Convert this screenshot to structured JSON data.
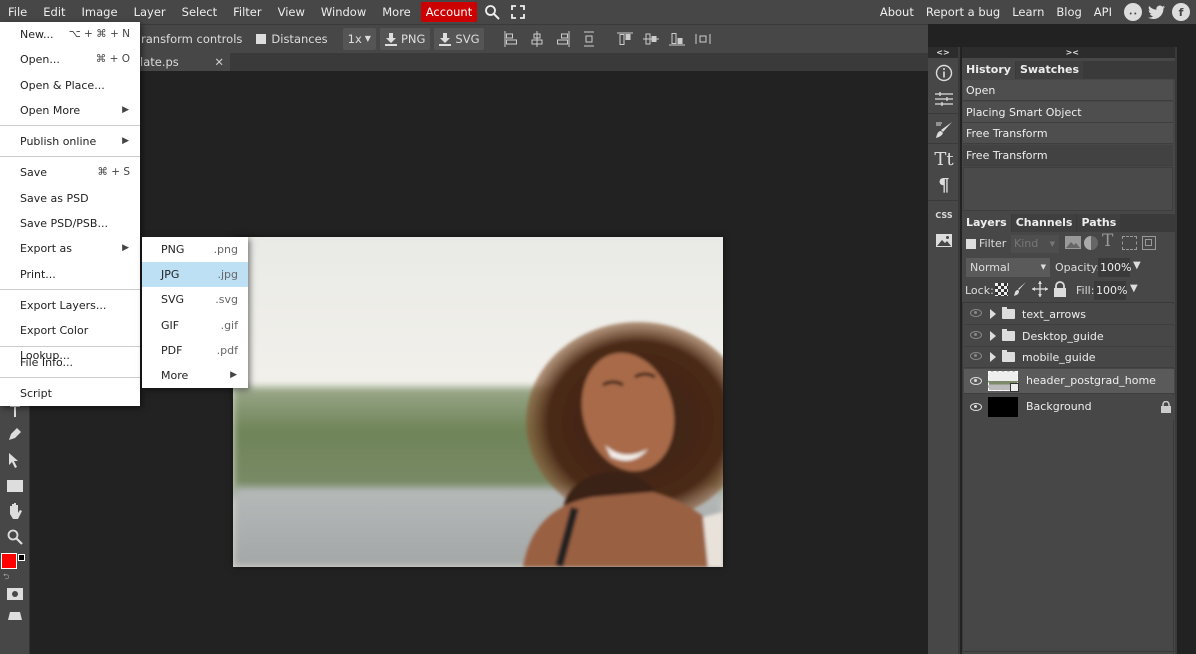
{
  "menubar": {
    "items": [
      "File",
      "Edit",
      "Image",
      "Layer",
      "Select",
      "Filter",
      "View",
      "Window",
      "More"
    ],
    "account": "Account",
    "icons": [
      "search-icon",
      "fullscreen-icon"
    ],
    "right_links": [
      "About",
      "Report a bug",
      "Learn",
      "Blog",
      "API"
    ],
    "social": [
      "reddit-icon",
      "twitter-icon",
      "facebook-icon"
    ]
  },
  "toolbar": {
    "transform_controls": "ransform controls",
    "distances": "Distances",
    "scale": "1x",
    "png": "PNG",
    "svg": "SVG"
  },
  "document": {
    "tab_label": "late.ps",
    "close": "✕"
  },
  "file_menu": {
    "items": [
      {
        "label": "New...",
        "shortcut": "⌥ + ⌘ + N"
      },
      {
        "label": "Open...",
        "shortcut": "⌘ + O"
      },
      {
        "label": "Open & Place..."
      },
      {
        "label": "Open More",
        "submenu": true
      },
      {
        "sep": true
      },
      {
        "label": "Publish online",
        "submenu": true
      },
      {
        "sep": true
      },
      {
        "label": "Save",
        "shortcut": "⌘ + S"
      },
      {
        "label": "Save as PSD"
      },
      {
        "label": "Save PSD/PSB..."
      },
      {
        "label": "Export as",
        "submenu": true
      },
      {
        "label": "Print..."
      },
      {
        "sep": true
      },
      {
        "label": "Export Layers..."
      },
      {
        "label": "Export Color Lookup..."
      },
      {
        "sep": true
      },
      {
        "label": "File Info..."
      },
      {
        "sep": true
      },
      {
        "label": "Script"
      }
    ],
    "arrow": "▶"
  },
  "export_submenu": {
    "items": [
      {
        "label": "PNG",
        "ext": ".png"
      },
      {
        "label": "JPG",
        "ext": ".jpg",
        "selected": true
      },
      {
        "label": "SVG",
        "ext": ".svg"
      },
      {
        "label": "GIF",
        "ext": ".gif"
      },
      {
        "label": "PDF",
        "ext": ".pdf"
      },
      {
        "label": "More",
        "submenu": true
      }
    ]
  },
  "panel_headers": {
    "icon_col": "<>",
    "right_panel": "><"
  },
  "history_panel": {
    "tabs": [
      "History",
      "Swatches"
    ],
    "items": [
      "Open",
      "Placing Smart Object",
      "Free Transform",
      "Free Transform"
    ]
  },
  "layers_panel": {
    "tabs": [
      "Layers",
      "Channels",
      "Paths"
    ],
    "filter_label": "Filter",
    "kind": "Kind",
    "blend_mode": "Normal",
    "opacity_label": "Opacity:",
    "opacity": "100%",
    "lock_label": "Lock:",
    "fill_label": "Fill:",
    "fill": "100%",
    "layers": [
      {
        "name": "text_arrows",
        "type": "group",
        "visible": false
      },
      {
        "name": "Desktop_guide",
        "type": "group",
        "visible": false
      },
      {
        "name": "mobile_guide",
        "type": "group",
        "visible": false
      },
      {
        "name": "header_postgrad_home",
        "type": "smart-object",
        "visible": true,
        "selected": true
      },
      {
        "name": "Background",
        "type": "background",
        "visible": true,
        "locked": true
      }
    ]
  },
  "colors": {
    "foreground": "#ff0000",
    "background": "#000000",
    "accent": "#cc0000",
    "menu_highlight": "#bde0f5"
  }
}
